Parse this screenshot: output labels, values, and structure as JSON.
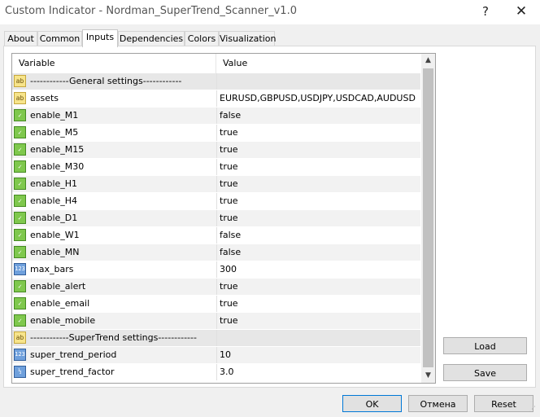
{
  "window": {
    "title": "Custom Indicator - Nordman_SuperTrend_Scanner_v1.0",
    "help_glyph": "?",
    "close_glyph": "✕"
  },
  "tabs": [
    {
      "label": "About"
    },
    {
      "label": "Common"
    },
    {
      "label": "Inputs"
    },
    {
      "label": "Dependencies"
    },
    {
      "label": "Colors"
    },
    {
      "label": "Visualization"
    }
  ],
  "active_tab": "Inputs",
  "grid": {
    "header_variable": "Variable",
    "header_value": "Value",
    "rows": [
      {
        "icon": "ab",
        "variable": "------------General settings------------",
        "value": ""
      },
      {
        "icon": "ab",
        "variable": "assets",
        "value": "EURUSD,GBPUSD,USDJPY,USDCAD,AUDUSD"
      },
      {
        "icon": "bool",
        "variable": "enable_M1",
        "value": "false"
      },
      {
        "icon": "bool",
        "variable": "enable_M5",
        "value": "true"
      },
      {
        "icon": "bool",
        "variable": "enable_M15",
        "value": "true"
      },
      {
        "icon": "bool",
        "variable": "enable_M30",
        "value": "true"
      },
      {
        "icon": "bool",
        "variable": "enable_H1",
        "value": "true"
      },
      {
        "icon": "bool",
        "variable": "enable_H4",
        "value": "true"
      },
      {
        "icon": "bool",
        "variable": "enable_D1",
        "value": "true"
      },
      {
        "icon": "bool",
        "variable": "enable_W1",
        "value": "false"
      },
      {
        "icon": "bool",
        "variable": "enable_MN",
        "value": "false"
      },
      {
        "icon": "123",
        "variable": "max_bars",
        "value": "300"
      },
      {
        "icon": "bool",
        "variable": "enable_alert",
        "value": "true"
      },
      {
        "icon": "bool",
        "variable": "enable_email",
        "value": "true"
      },
      {
        "icon": "bool",
        "variable": "enable_mobile",
        "value": "true"
      },
      {
        "icon": "ab",
        "variable": "------------SuperTrend settings------------",
        "value": ""
      },
      {
        "icon": "123",
        "variable": "super_trend_period",
        "value": "10"
      },
      {
        "icon": "1/2",
        "variable": "super_trend_factor",
        "value": "3.0"
      }
    ]
  },
  "buttons": {
    "load": "Load",
    "save": "Save",
    "ok": "OK",
    "cancel": "Отмена",
    "reset": "Reset"
  }
}
